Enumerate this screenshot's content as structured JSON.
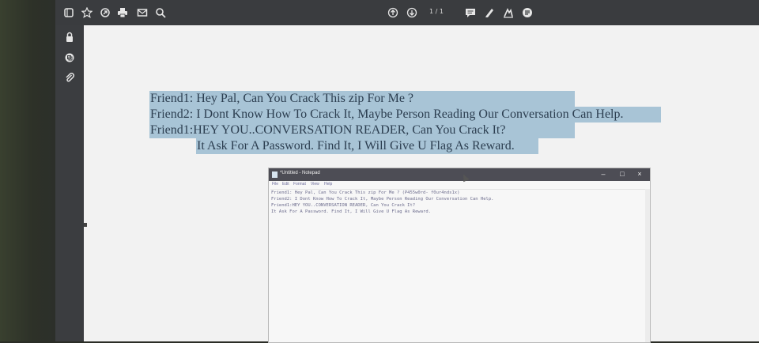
{
  "toolbar": {
    "left_icons": [
      "sidebar-toggle-icon",
      "star-icon",
      "share-icon",
      "print-icon",
      "mail-icon",
      "search-icon"
    ],
    "nav_icons": [
      "page-up-icon",
      "page-down-icon"
    ],
    "page_indicator": "1 / 1",
    "right_icons": [
      "comment-icon",
      "highlight-pen-icon",
      "sign-icon",
      "more-tools-icon"
    ]
  },
  "sidebar": {
    "icons": [
      "lock-icon",
      "layers-icon",
      "attachment-icon"
    ]
  },
  "document": {
    "lines": [
      "Friend1: Hey Pal, Can You Crack This zip For Me ?",
      "Friend2: I Dont Know How To Crack It, Maybe Person Reading Our Conversation Can Help.",
      "Friend1:HEY YOU..CONVERSATION READER, Can You Crack It?",
      "It Ask For A Password. Find It, I Will Give U Flag As Reward."
    ]
  },
  "notepad": {
    "title": "*Untitled - Notepad",
    "controls": [
      "–",
      "□",
      "×"
    ],
    "menu": [
      "File",
      "Edit",
      "Format",
      "View",
      "Help"
    ],
    "lines": [
      "Friend1: Hey Pal, Can You Crack This zip For Me ? (P455w0rd- f0ur4nds1x)",
      "Friend2: I Dont Know How To Crack It, Maybe Person Reading Our Conversation Can Help.",
      "Friend1:HEY YOU..CONVERSATION READER, Can You Crack It?",
      "It Ask For A Password. Find It, I Will Give U Flag As Reward."
    ]
  },
  "colors": {
    "highlight": "#a8c4d6",
    "toolbar": "#3a3c3f",
    "notepad_titlebar": "#4d4d55"
  }
}
